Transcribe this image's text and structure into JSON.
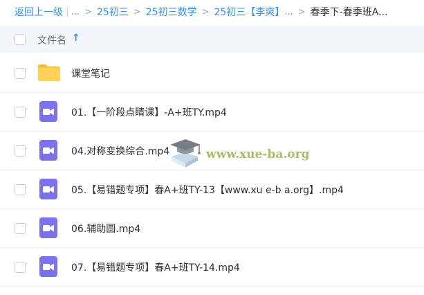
{
  "breadcrumb": {
    "back": "返回上一级",
    "divider": "|",
    "ellipsis": "...",
    "separator": ">",
    "crumbs": [
      "25初三",
      "25初三数学",
      "25初三【李爽】"
    ],
    "crumb_trailing_ellipsis": "...",
    "current": "春季下-春季班A..."
  },
  "header": {
    "filename_label": "文件名",
    "sort_icon": "sort-ascending-arrow-icon"
  },
  "files": [
    {
      "name": "课堂笔记",
      "type": "folder",
      "icon": "folder-icon"
    },
    {
      "name": "01.【一阶段点睛课】-A+班TY.mp4",
      "type": "video",
      "icon": "video-file-icon"
    },
    {
      "name": "04.对称变换综合.mp4",
      "type": "video",
      "icon": "video-file-icon"
    },
    {
      "name": "05.【易错题专项】春A+班TY-13【www.xu e-b a.org】.mp4",
      "type": "video",
      "icon": "video-file-icon"
    },
    {
      "name": "06.辅助圆.mp4",
      "type": "video",
      "icon": "video-file-icon"
    },
    {
      "name": "07.【易错题专项】春A+班TY-14.mp4",
      "type": "video",
      "icon": "video-file-icon"
    }
  ],
  "watermark": {
    "text": "www.xue-ba.org",
    "icon": "graduation-cap-book-icon"
  },
  "colors": {
    "link": "#2f8ff5",
    "header_bg": "#f2f5f9",
    "folder": "#fcd15a",
    "video": "#7c72ea",
    "watermark": "#9ab24a"
  }
}
